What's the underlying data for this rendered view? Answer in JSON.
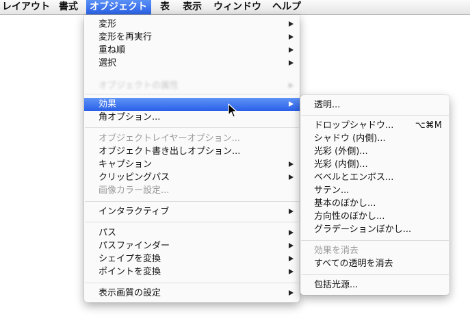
{
  "menubar": {
    "items": [
      "レイアウト",
      "書式",
      "オブジェクト",
      "表",
      "表示",
      "ウィンドウ",
      "ヘルプ"
    ],
    "active_index": 2,
    "active_color": "#2b62e6"
  },
  "object_menu": {
    "items": [
      {
        "label": "変形",
        "submenu": true
      },
      {
        "label": "変形を再実行",
        "submenu": true
      },
      {
        "label": "重ね順",
        "submenu": true
      },
      {
        "label": "選択",
        "submenu": true
      },
      {
        "label": "オブジェクトの属性",
        "submenu": true,
        "state": "obscured"
      },
      {
        "label": "効果",
        "submenu": true,
        "state": "selected"
      },
      {
        "label": "角オプション..."
      },
      {
        "label": "オブジェクトレイヤーオプション...",
        "state": "disabled"
      },
      {
        "label": "オブジェクト書き出しオプション..."
      },
      {
        "label": "キャプション",
        "submenu": true
      },
      {
        "label": "クリッピングパス",
        "submenu": true
      },
      {
        "label": "画像カラー設定...",
        "state": "disabled"
      },
      {
        "label": "インタラクティブ",
        "submenu": true
      },
      {
        "label": "パス",
        "submenu": true
      },
      {
        "label": "パスファインダー",
        "submenu": true
      },
      {
        "label": "シェイプを変換",
        "submenu": true
      },
      {
        "label": "ポイントを変換",
        "submenu": true
      },
      {
        "label": "表示画質の設定",
        "submenu": true
      }
    ]
  },
  "effects_submenu": {
    "items": [
      {
        "label": "透明..."
      },
      {
        "label": "ドロップシャドウ...",
        "shortcut": "⌥⌘M"
      },
      {
        "label": "シャドウ (内側)..."
      },
      {
        "label": "光彩 (外側)..."
      },
      {
        "label": "光彩 (内側)..."
      },
      {
        "label": "ベベルとエンボス..."
      },
      {
        "label": "サテン..."
      },
      {
        "label": "基本のぼかし..."
      },
      {
        "label": "方向性のぼかし..."
      },
      {
        "label": "グラデーションぼかし..."
      },
      {
        "label": "効果を消去",
        "state": "disabled"
      },
      {
        "label": "すべての透明を消去"
      },
      {
        "label": "包括光源..."
      }
    ]
  },
  "colors": {
    "highlight": "#2a60e8",
    "disabled_text": "#9a9a9a"
  }
}
